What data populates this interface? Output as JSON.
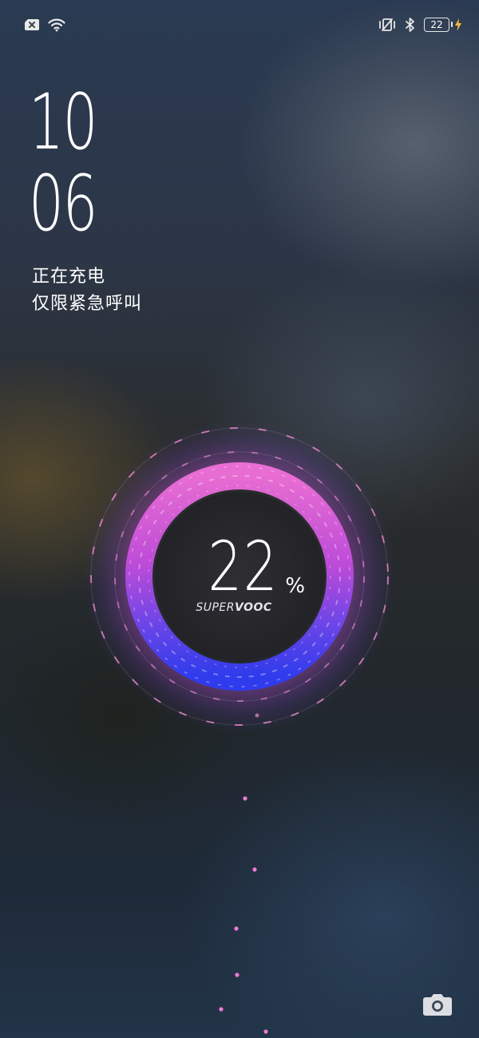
{
  "status_bar": {
    "left_icons": [
      "sim-error-icon",
      "wifi-icon"
    ],
    "right_icons": [
      "vibrate-icon",
      "bluetooth-icon",
      "battery-icon",
      "charging-bolt-icon"
    ],
    "battery_level": "22"
  },
  "lockscreen": {
    "clock_hour": "10",
    "clock_minute": "06",
    "charging_text": "正在充电",
    "emergency_text": "仅限紧急呼叫"
  },
  "charging": {
    "percent": "22",
    "percent_sign": "%",
    "brand_prefix": "SUPER",
    "brand_suffix": "VOOC",
    "level_fraction": 0.22
  },
  "actions": {
    "camera_icon": "camera-icon"
  },
  "colors": {
    "ring_pink": "#e25fd2",
    "ring_blue": "#3a3cf2",
    "particle": "#f07ad6",
    "bolt": "#f5b63a"
  }
}
